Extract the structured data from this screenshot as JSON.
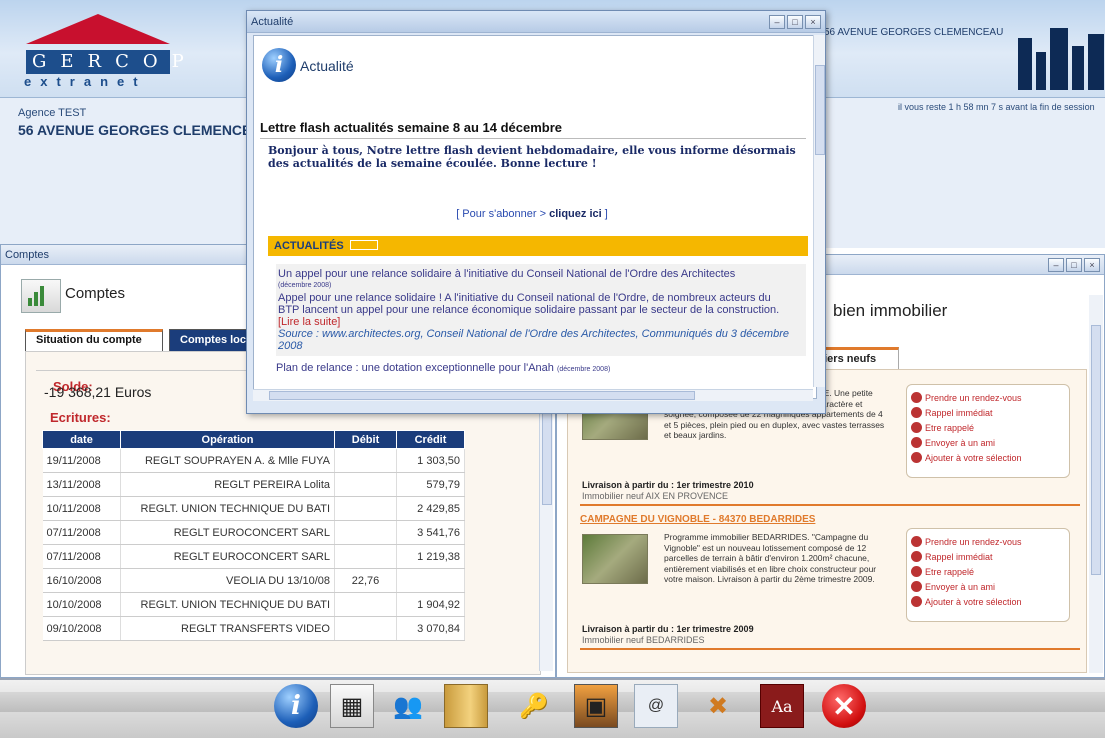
{
  "header": {
    "logo_line1": "GERCOP",
    "logo_line2": "extranet",
    "agence_label": "Agence TEST",
    "agence_address": "56 AVENUE GEORGES CLEMENCEAU",
    "address_right": "56 AVENUE GEORGES CLEMENCEAU",
    "session_text": "il vous reste 1 h 58 mn 7 s avant la fin de session"
  },
  "comptes": {
    "window_title": "Comptes",
    "heading": "Comptes",
    "tabs": [
      "Situation du compte",
      "Comptes locataires"
    ],
    "solde_label": "Solde:",
    "solde_value": "-19 368,21 Euros",
    "ecritures_label": "Ecritures:",
    "columns": [
      "date",
      "Opération",
      "Débit",
      "Crédit"
    ],
    "rows": [
      [
        "19/11/2008",
        "REGLT SOUPRAYEN A. & Mlle FUYA",
        "",
        "1 303,50"
      ],
      [
        "13/11/2008",
        "REGLT PEREIRA Lolita",
        "",
        "579,79"
      ],
      [
        "10/11/2008",
        "REGLT. UNION TECHNIQUE DU BATI",
        "",
        "2 429,85"
      ],
      [
        "07/11/2008",
        "REGLT EUROCONCERT SARL",
        "",
        "3 541,76"
      ],
      [
        "07/11/2008",
        "REGLT EUROCONCERT SARL",
        "",
        "1 219,38"
      ],
      [
        "16/10/2008",
        "VEOLIA DU 13/10/08",
        "22,76",
        ""
      ],
      [
        "10/10/2008",
        "REGLT. UNION TECHNIQUE DU BATI",
        "",
        "1 904,92"
      ],
      [
        "09/10/2008",
        "REGLT TRANSFERTS VIDEO",
        "",
        "3 070,84"
      ]
    ]
  },
  "immo": {
    "title": "bien immobilier",
    "tab": "iliers neufs",
    "programs": [
      {
        "title": "",
        "desc": "Programme immobilier AIX EN PROVENCE. Une petite résidence d'exception à l'architecture de caractère et soignée, composée de 22 magnifiques appartements de 4 et 5 pièces, plein pied ou en duplex, avec vastes terrasses et beaux jardins.",
        "delivery": "Livraison à partir du : 1er trimestre 2010",
        "location": "Immobilier neuf AIX EN PROVENCE"
      },
      {
        "title": "CAMPAGNE DU VIGNOBLE - 84370 BEDARRIDES",
        "desc": "Programme immobilier BEDARRIDES. \"Campagne du Vignoble\" est un nouveau lotissement composé de 12 parcelles de terrain à bâtir d'environ 1.200m² chacune, entièrement viabilisés et en libre choix constructeur pour votre maison. Livraison à partir du 2ème trimestre 2009.",
        "delivery": "Livraison à partir du : 1er trimestre 2009",
        "location": "Immobilier neuf BEDARRIDES"
      }
    ],
    "actions": [
      "Prendre un rendez-vous",
      "Rappel immédiat",
      "Etre rappelé",
      "Envoyer à un ami",
      "Ajouter à votre sélection"
    ]
  },
  "actu": {
    "window_title": "Actualité",
    "logo_text": "Actualité",
    "heading": "Lettre flash actualités semaine 8 au 14 décembre",
    "intro": "Bonjour à tous, Notre lettre flash devient hebdomadaire, elle vous informe désormais des actualités de la semaine écoulée. Bonne lecture !",
    "subscribe_prefix": "[ Pour s'abonner > ",
    "subscribe_link": "cliquez ici",
    "subscribe_suffix": " ]",
    "section": "ACTUALITÉS",
    "news1_title": "Un appel pour une relance solidaire à l'initiative du Conseil National de l'Ordre des Architectes",
    "news1_date": "(décembre 2008)",
    "news1_body1": "Appel pour une relance solidaire ! A l'initiative du Conseil national de l'Ordre, de nombreux acteurs du",
    "news1_body2": "BTP lancent un appel pour une relance économique solidaire passant par le secteur de la construction.",
    "news1_more": "[Lire la suite]",
    "news1_source": "Source : www.architectes.org, Conseil National de l'Ordre des Architectes, Communiqués du 3 décembre",
    "news1_year": "2008",
    "news2_title": "Plan de relance : une dotation exceptionnelle pour l'Anah",
    "news2_date": "(décembre 2008)"
  },
  "dock": {
    "icons": [
      "info-icon",
      "accounts-chart-icon",
      "contacts-icon",
      "documents-folder-icon",
      "keys-icon",
      "photo-icon",
      "email-icon",
      "tools-icon",
      "dictionary-icon",
      "close-app-icon"
    ]
  }
}
